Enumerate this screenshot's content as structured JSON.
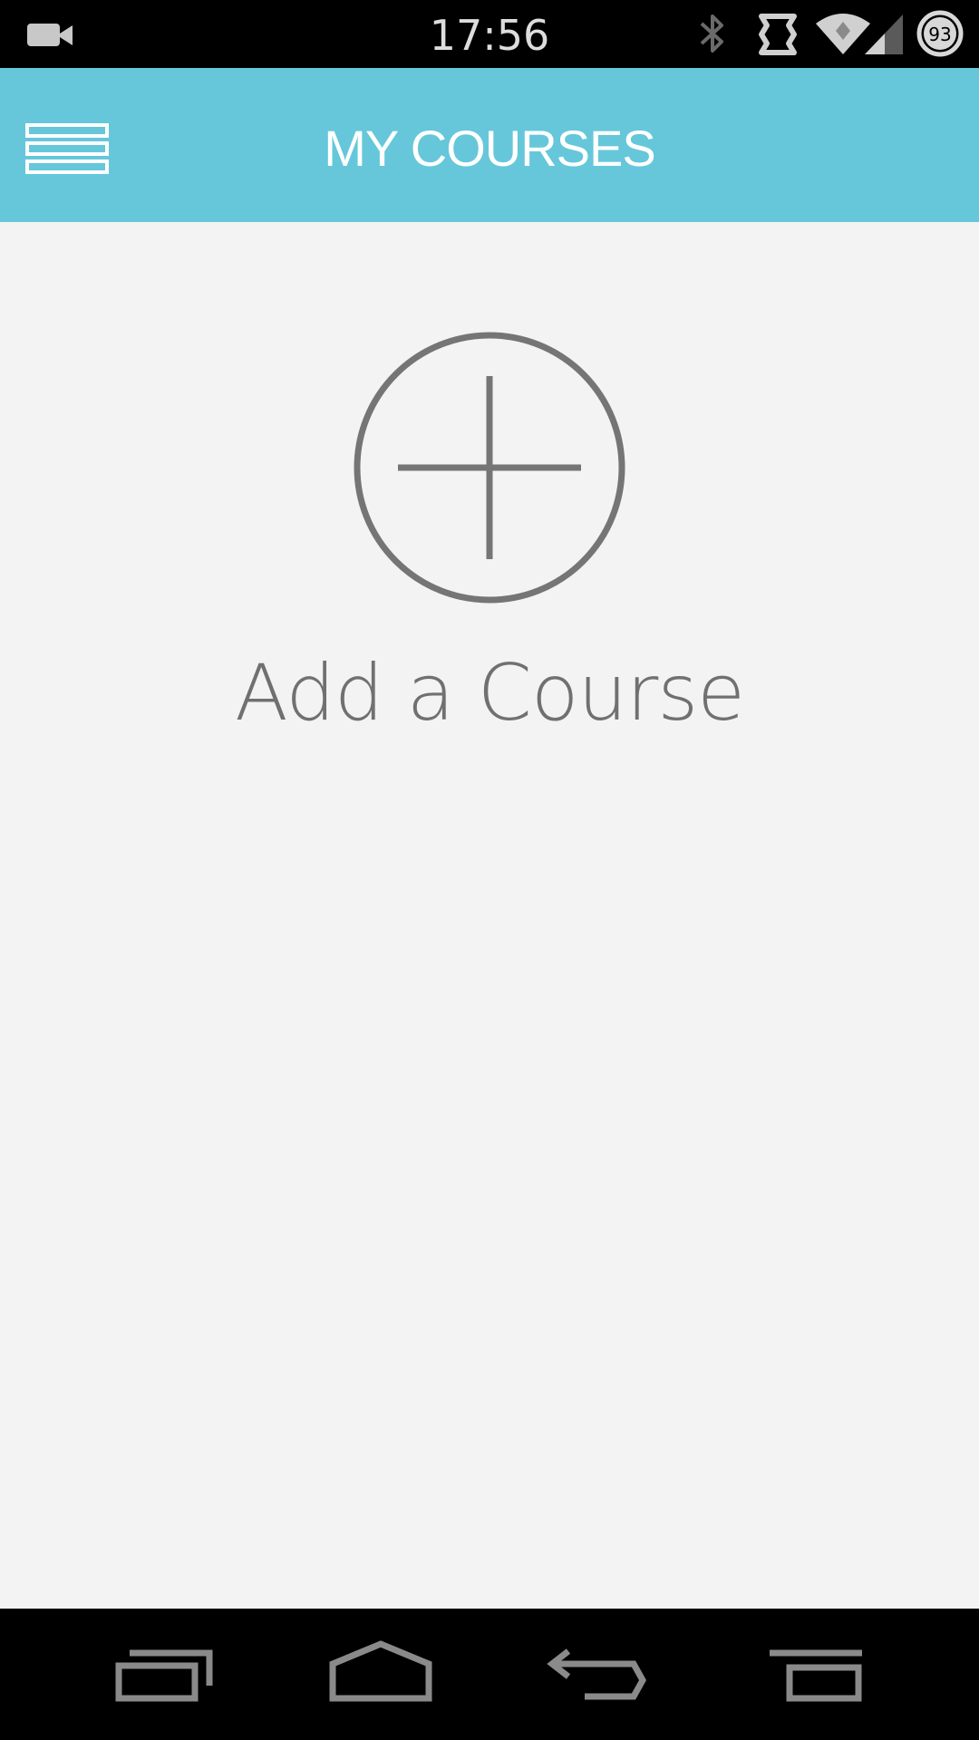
{
  "status_bar": {
    "time": "17:56",
    "battery_level": "93",
    "icons": [
      "video-camera-icon",
      "bluetooth-icon",
      "data-sync-icon",
      "wifi-icon",
      "cell-signal-icon",
      "battery-icon"
    ]
  },
  "app_bar": {
    "title": "MY COURSES",
    "menu_icon": "hamburger-menu-icon",
    "background_color": "#66c7da"
  },
  "main": {
    "add_course_icon": "plus-circle-icon",
    "add_course_label": "Add a Course"
  },
  "nav_bar": {
    "buttons": [
      "recent-apps-icon",
      "home-icon",
      "back-icon",
      "menu-icon"
    ]
  }
}
